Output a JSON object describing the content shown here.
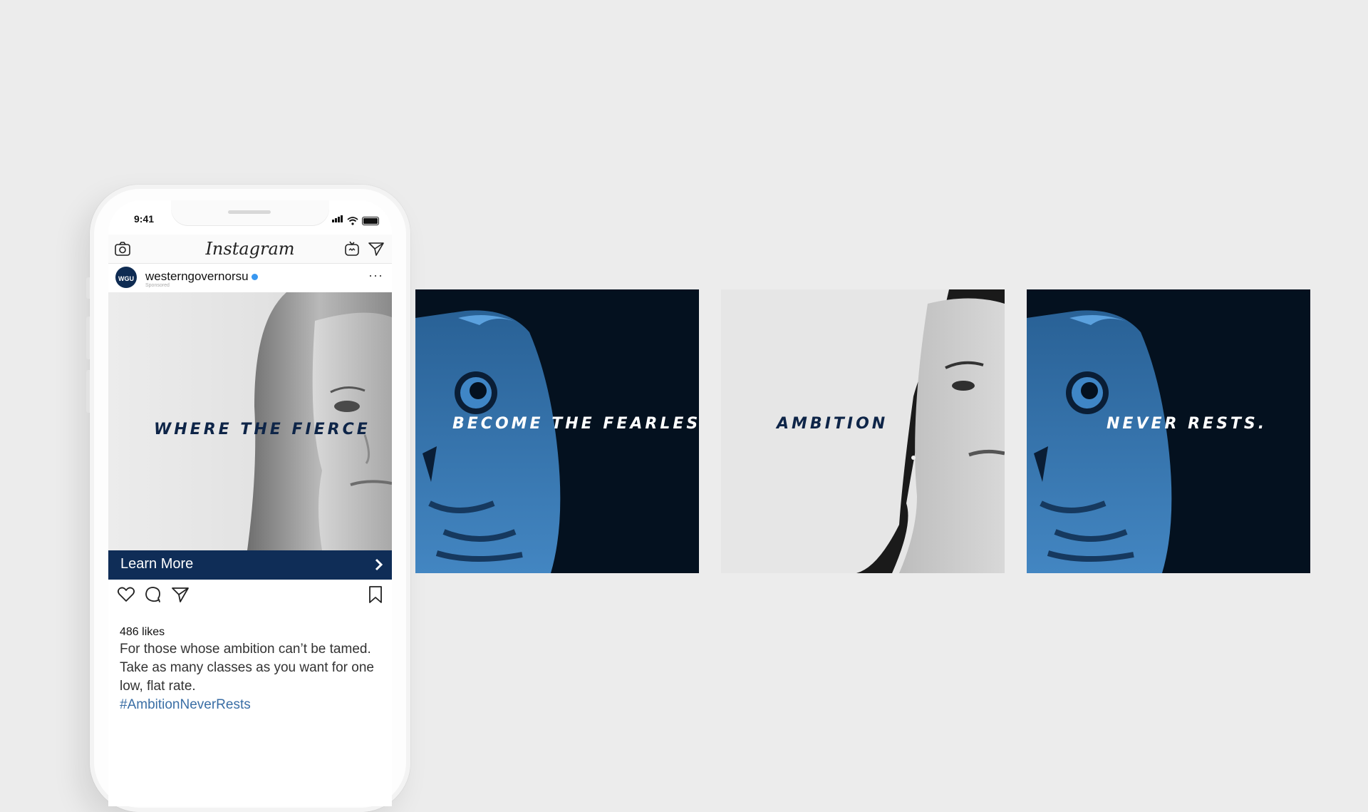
{
  "status": {
    "time": "9:41"
  },
  "app": {
    "name": "Instagram"
  },
  "post": {
    "username": "westerngovernorsu",
    "sponsored_label": "Sponsored",
    "avatar_text": "WGU",
    "cta_label": "Learn More",
    "likes": "486 likes",
    "caption": "For those whose ambition can’t be tamed. Take as many classes as you want for one low, flat rate.",
    "hashtag": "#AmbitionNeverRests"
  },
  "panels": [
    {
      "tagline": "WHERE THE FIERCE",
      "theme": "light",
      "image": "woman-blonde-portrait"
    },
    {
      "tagline": "BECOME THE FEARLESS.",
      "theme": "dark",
      "image": "owl-blue"
    },
    {
      "tagline": "AMBITION",
      "theme": "light",
      "image": "woman-dark-hair-portrait"
    },
    {
      "tagline": "NEVER RESTS.",
      "theme": "dark",
      "image": "owl-blue"
    }
  ],
  "colors": {
    "background": "#ececec",
    "brand_navy": "#0f2d57",
    "owl_blue": "#3f86c6",
    "panel_dark": "#04111f",
    "hashtag_blue": "#3a6ea5"
  },
  "icons": [
    "camera-icon",
    "igtv-icon",
    "direct-message-icon",
    "more-icon",
    "heart-icon",
    "comment-icon",
    "share-icon",
    "bookmark-icon",
    "chevron-right-icon"
  ]
}
